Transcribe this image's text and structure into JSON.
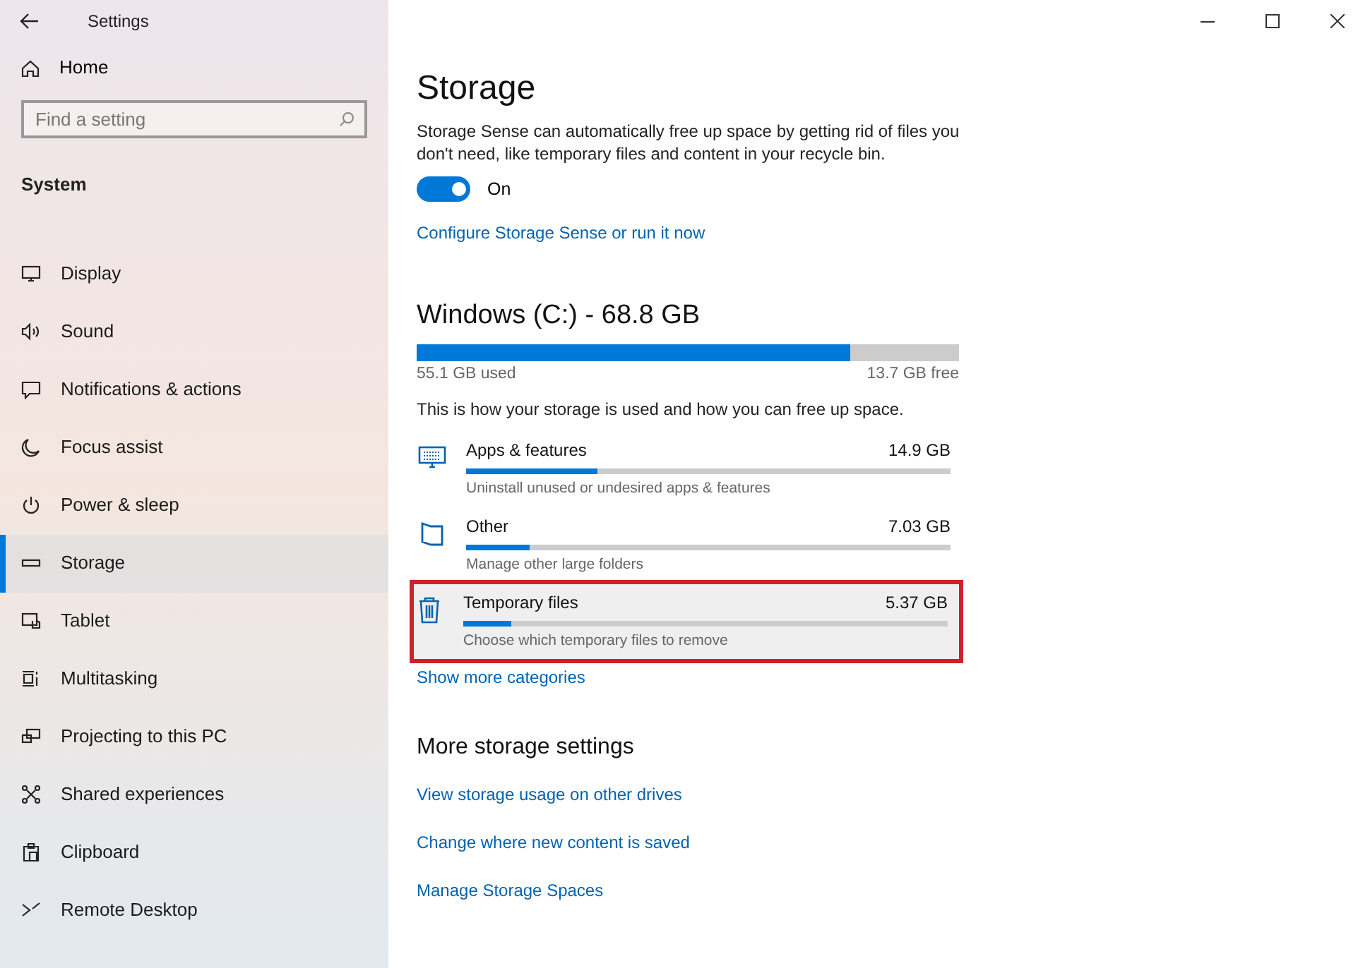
{
  "window": {
    "title": "Settings"
  },
  "sidebar": {
    "home": "Home",
    "search": {
      "placeholder": "Find a setting"
    },
    "section": "System",
    "items": [
      {
        "label": "Display",
        "selected": false
      },
      {
        "label": "Sound",
        "selected": false
      },
      {
        "label": "Notifications & actions",
        "selected": false
      },
      {
        "label": "Focus assist",
        "selected": false
      },
      {
        "label": "Power & sleep",
        "selected": false
      },
      {
        "label": "Storage",
        "selected": true
      },
      {
        "label": "Tablet",
        "selected": false
      },
      {
        "label": "Multitasking",
        "selected": false
      },
      {
        "label": "Projecting to this PC",
        "selected": false
      },
      {
        "label": "Shared experiences",
        "selected": false
      },
      {
        "label": "Clipboard",
        "selected": false
      },
      {
        "label": "Remote Desktop",
        "selected": false
      }
    ]
  },
  "page": {
    "title": "Storage",
    "description": "Storage Sense can automatically free up space by getting rid of files you don't need, like temporary files and content in your recycle bin.",
    "storage_sense": {
      "on": true,
      "label": "On"
    },
    "configure_link": "Configure Storage Sense or run it now",
    "drive": {
      "title": "Windows (C:) - 68.8 GB",
      "level": 0.8,
      "used": "55.1 GB used",
      "free": "13.7 GB free"
    },
    "usage_note": "This is how your storage is used and how you can free up space.",
    "categories": [
      {
        "name": "Apps & features",
        "size": "14.9 GB",
        "level": 0.27,
        "hint": "Uninstall unused or undesired apps & features",
        "highlighted": false
      },
      {
        "name": "Other",
        "size": "7.03 GB",
        "level": 0.13,
        "hint": "Manage other large folders",
        "highlighted": false
      },
      {
        "name": "Temporary files",
        "size": "5.37 GB",
        "level": 0.1,
        "hint": "Choose which temporary files to remove",
        "highlighted": true
      }
    ],
    "show_more": "Show more categories",
    "more_title": "More storage settings",
    "more_links": [
      "View storage usage on other drives",
      "Change where new content is saved",
      "Manage Storage Spaces"
    ]
  }
}
